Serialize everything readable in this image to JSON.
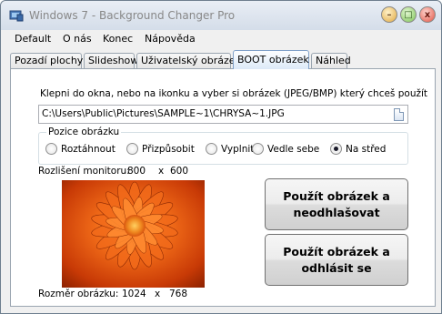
{
  "window": {
    "title": "Windows 7 - Background Changer Pro",
    "controls": {
      "minimize": "–",
      "maximize": "□",
      "close": "x"
    }
  },
  "menu": {
    "items": [
      "Default",
      "O nás",
      "Konec",
      "Nápověda"
    ]
  },
  "tabs": [
    {
      "label": "Pozadí plochy",
      "active": false
    },
    {
      "label": "Slideshow",
      "active": false
    },
    {
      "label": "Uživatelský obrázek",
      "active": false
    },
    {
      "label": "BOOT obrázek",
      "active": true
    },
    {
      "label": "Náhled",
      "active": false
    }
  ],
  "boot": {
    "instruction": "Klepni do okna, nebo na ikonku a vyber si obrázek (JPEG/BMP) který chceš použít",
    "path_value": "C:\\Users\\Public\\Pictures\\SAMPLE~1\\CHRYSA~1.JPG",
    "position": {
      "legend": "Pozice obrázku",
      "options": [
        {
          "label": "Roztáhnout",
          "selected": false
        },
        {
          "label": "Přizpůsobit",
          "selected": false
        },
        {
          "label": "Vyplnit",
          "selected": false
        },
        {
          "label": "Vedle sebe",
          "selected": false
        },
        {
          "label": "Na střed",
          "selected": true
        }
      ]
    },
    "resolution": {
      "label": "Rozlišení monitoru:",
      "width": "800",
      "sep": "x",
      "height": "600"
    },
    "image_size": {
      "label": "Rozměr obrázku:",
      "width": "1024",
      "sep": "x",
      "height": "768"
    },
    "buttons": {
      "use_logoff": "Použít obrázek a\nneodhlašovat",
      "use_logout": "Použít obrázek a\nodhlásit se"
    }
  },
  "colors": {
    "flower": "#e04a10",
    "tab_active": "#dce9f7"
  }
}
